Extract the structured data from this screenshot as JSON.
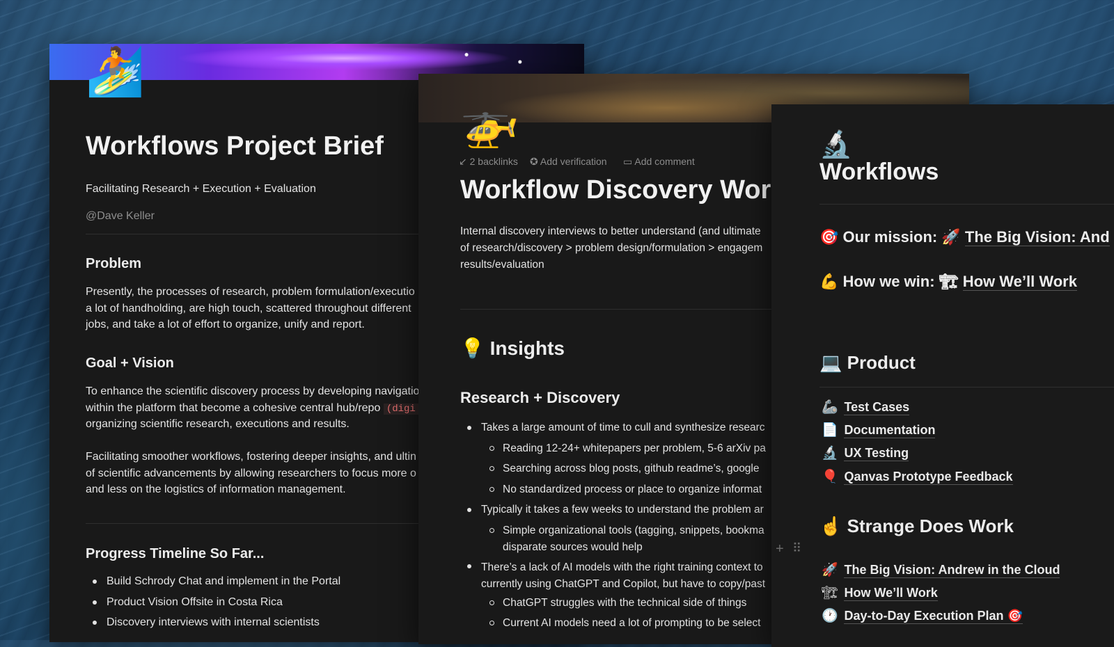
{
  "brief": {
    "icon": "🏄",
    "title": "Workflows Project Brief",
    "subtitle": "Facilitating Research + Execution + Evaluation",
    "mention": "@Dave Keller",
    "problem_heading": "Problem",
    "problem_lines": [
      "Presently, the processes of research, problem formulation/executio",
      "a lot of handholding, are high touch, scattered throughout different",
      "jobs, and take a lot of effort to organize, unify and report."
    ],
    "goal_heading": "Goal + Vision",
    "goal_lines_1": "To enhance the scientific discovery process by developing navigatio",
    "goal_lines_2": "within the platform that become a cohesive central hub/repo",
    "goal_code": "(digi",
    "goal_lines_3": "organizing scientific research, executions and results.",
    "goal2_lines": [
      "Facilitating smoother workflows, fostering deeper insights, and ultin",
      "of scientific advancements by allowing researchers to focus more o",
      "and less on the logistics of information management."
    ],
    "progress_heading": "Progress Timeline So Far...",
    "progress_items": [
      "Build Schrody Chat and implement in the Portal",
      "Product Vision Offsite in Costa Rica",
      "Discovery interviews with internal scientists"
    ]
  },
  "discovery": {
    "icon": "🚁",
    "backlinks": "2 backlinks",
    "add_verification": "Add verification",
    "add_comment": "Add comment",
    "title": "Workflow Discovery Wor",
    "intro_lines": [
      "Internal discovery interviews to better understand (and ultimate",
      "of research/discovery > problem design/formulation > engagem",
      "results/evaluation"
    ],
    "insights_icon": "💡",
    "insights_heading": "Insights",
    "research_heading": "Research + Discovery",
    "bullets": [
      "Takes a large amount of time to cull and synthesize researc",
      "Reading 12-24+ whitepapers per problem, 5-6 arXiv pa",
      "Searching across blog posts, github readme’s, google",
      "No standardized process or place to organize informat",
      "Typically it takes a few weeks to understand the problem ar",
      "Simple organizational tools (tagging, snippets, bookma",
      "disparate sources would help",
      "There’s a lack of AI models with the right training context to",
      "currently using ChatGPT and Copilot, but have to copy/past",
      "ChatGPT struggles with the technical side of things",
      "Current AI models need a lot of prompting to be select"
    ]
  },
  "workflows": {
    "icon": "🔬",
    "title": "Workflows",
    "mission_icon": "🎯",
    "mission_label": "Our mission:",
    "mission_link_icon": "🚀",
    "mission_link": "The Big Vision: And",
    "win_icon": "💪",
    "win_label": "How we win:",
    "win_link_icon": "🏗",
    "win_link": "How We’ll Work",
    "product_icon": "💻",
    "product_heading": "Product",
    "product_items": [
      {
        "icon": "🦾",
        "label": "Test Cases"
      },
      {
        "icon": "📄",
        "label": "Documentation"
      },
      {
        "icon": "🔬",
        "label": "UX Testing"
      },
      {
        "icon": "🎈",
        "label": "Qanvas Prototype Feedback"
      }
    ],
    "strange_icon": "☝",
    "strange_heading": "Strange Does Work",
    "strange_items": [
      {
        "icon": "🚀",
        "label": "The Big Vision: Andrew in the Cloud"
      },
      {
        "icon": "🏗",
        "label": "How We’ll Work"
      },
      {
        "icon": "🕐",
        "label": "Day-to-Day Execution Plan 🎯"
      }
    ],
    "gutter_plus": "+",
    "gutter_drag": "⠿"
  }
}
